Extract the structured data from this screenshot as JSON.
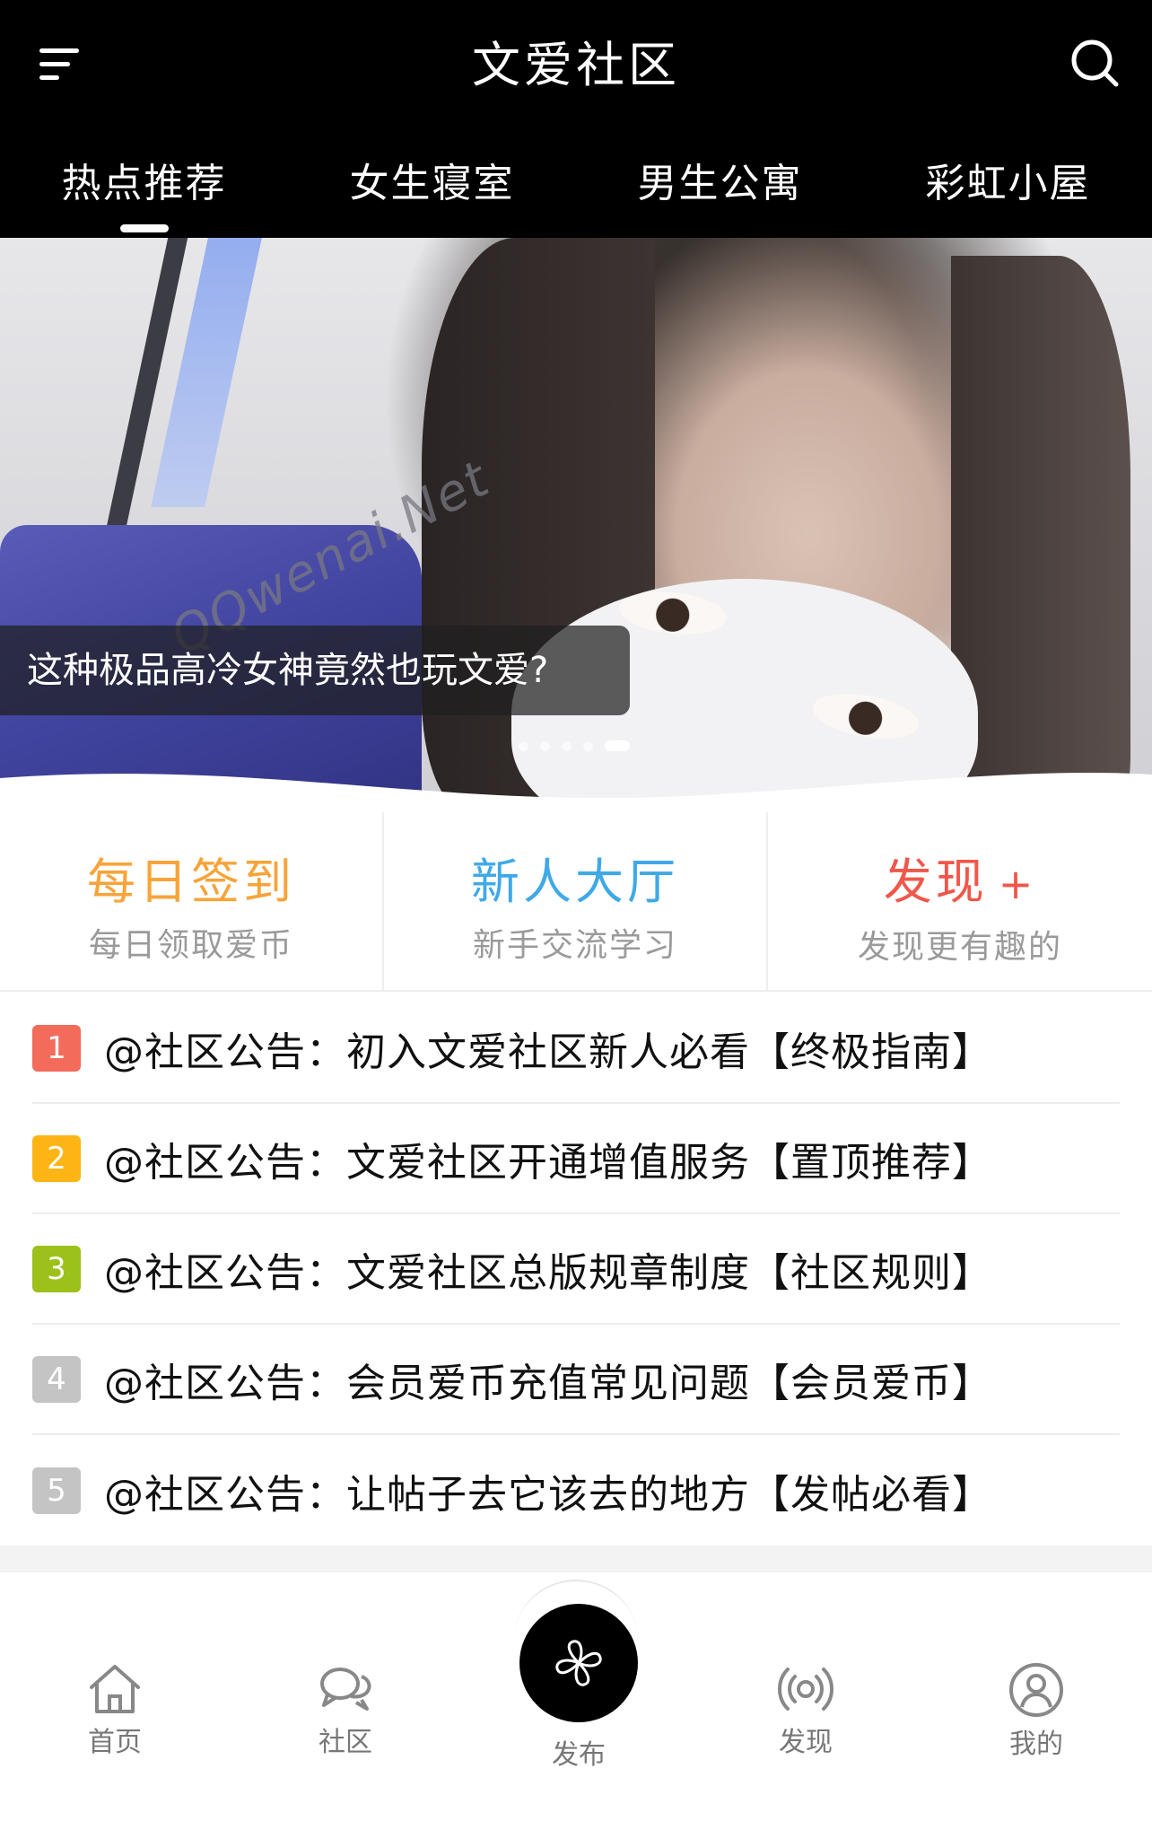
{
  "header": {
    "title": "文爱社区",
    "menu_icon": "menu-icon",
    "search_icon": "search-icon",
    "tabs": [
      {
        "label": "热点推荐",
        "active": true
      },
      {
        "label": "女生寝室",
        "active": false
      },
      {
        "label": "男生公寓",
        "active": false
      },
      {
        "label": "彩虹小屋",
        "active": false
      }
    ]
  },
  "banner": {
    "watermark": "QQwenai.Net",
    "caption": "这种极品高冷女神竟然也玩文爱?",
    "slide_count": 5,
    "active_slide": 5
  },
  "quick_entries": [
    {
      "title": "每日签到",
      "subtitle": "每日领取爱币",
      "color": "#f7a43a"
    },
    {
      "title": "新人大厅",
      "subtitle": "新手交流学习",
      "color": "#3fa9e8"
    },
    {
      "title": "发现",
      "extra": "+",
      "subtitle": "发现更有趣的",
      "color": "#f0574a"
    }
  ],
  "notices": [
    {
      "rank": "1",
      "text": "@社区公告：初入文爱社区新人必看【终极指南】",
      "color": "#f26b5b"
    },
    {
      "rank": "2",
      "text": "@社区公告：文爱社区开通增值服务【置顶推荐】",
      "color": "#fcb514"
    },
    {
      "rank": "3",
      "text": "@社区公告：文爱社区总版规章制度【社区规则】",
      "color": "#9bc11a"
    },
    {
      "rank": "4",
      "text": "@社区公告：会员爱币充值常见问题【会员爱币】",
      "color": "#c4c4c4"
    },
    {
      "rank": "5",
      "text": "@社区公告：让帖子去它该去的地方【发帖必看】",
      "color": "#c4c4c4"
    }
  ],
  "bottom_nav": [
    {
      "label": "首页",
      "icon": "home-icon"
    },
    {
      "label": "社区",
      "icon": "chat-icon"
    },
    {
      "label": "发布",
      "icon": "pinwheel-icon"
    },
    {
      "label": "发现",
      "icon": "broadcast-icon"
    },
    {
      "label": "我的",
      "icon": "user-icon"
    }
  ]
}
